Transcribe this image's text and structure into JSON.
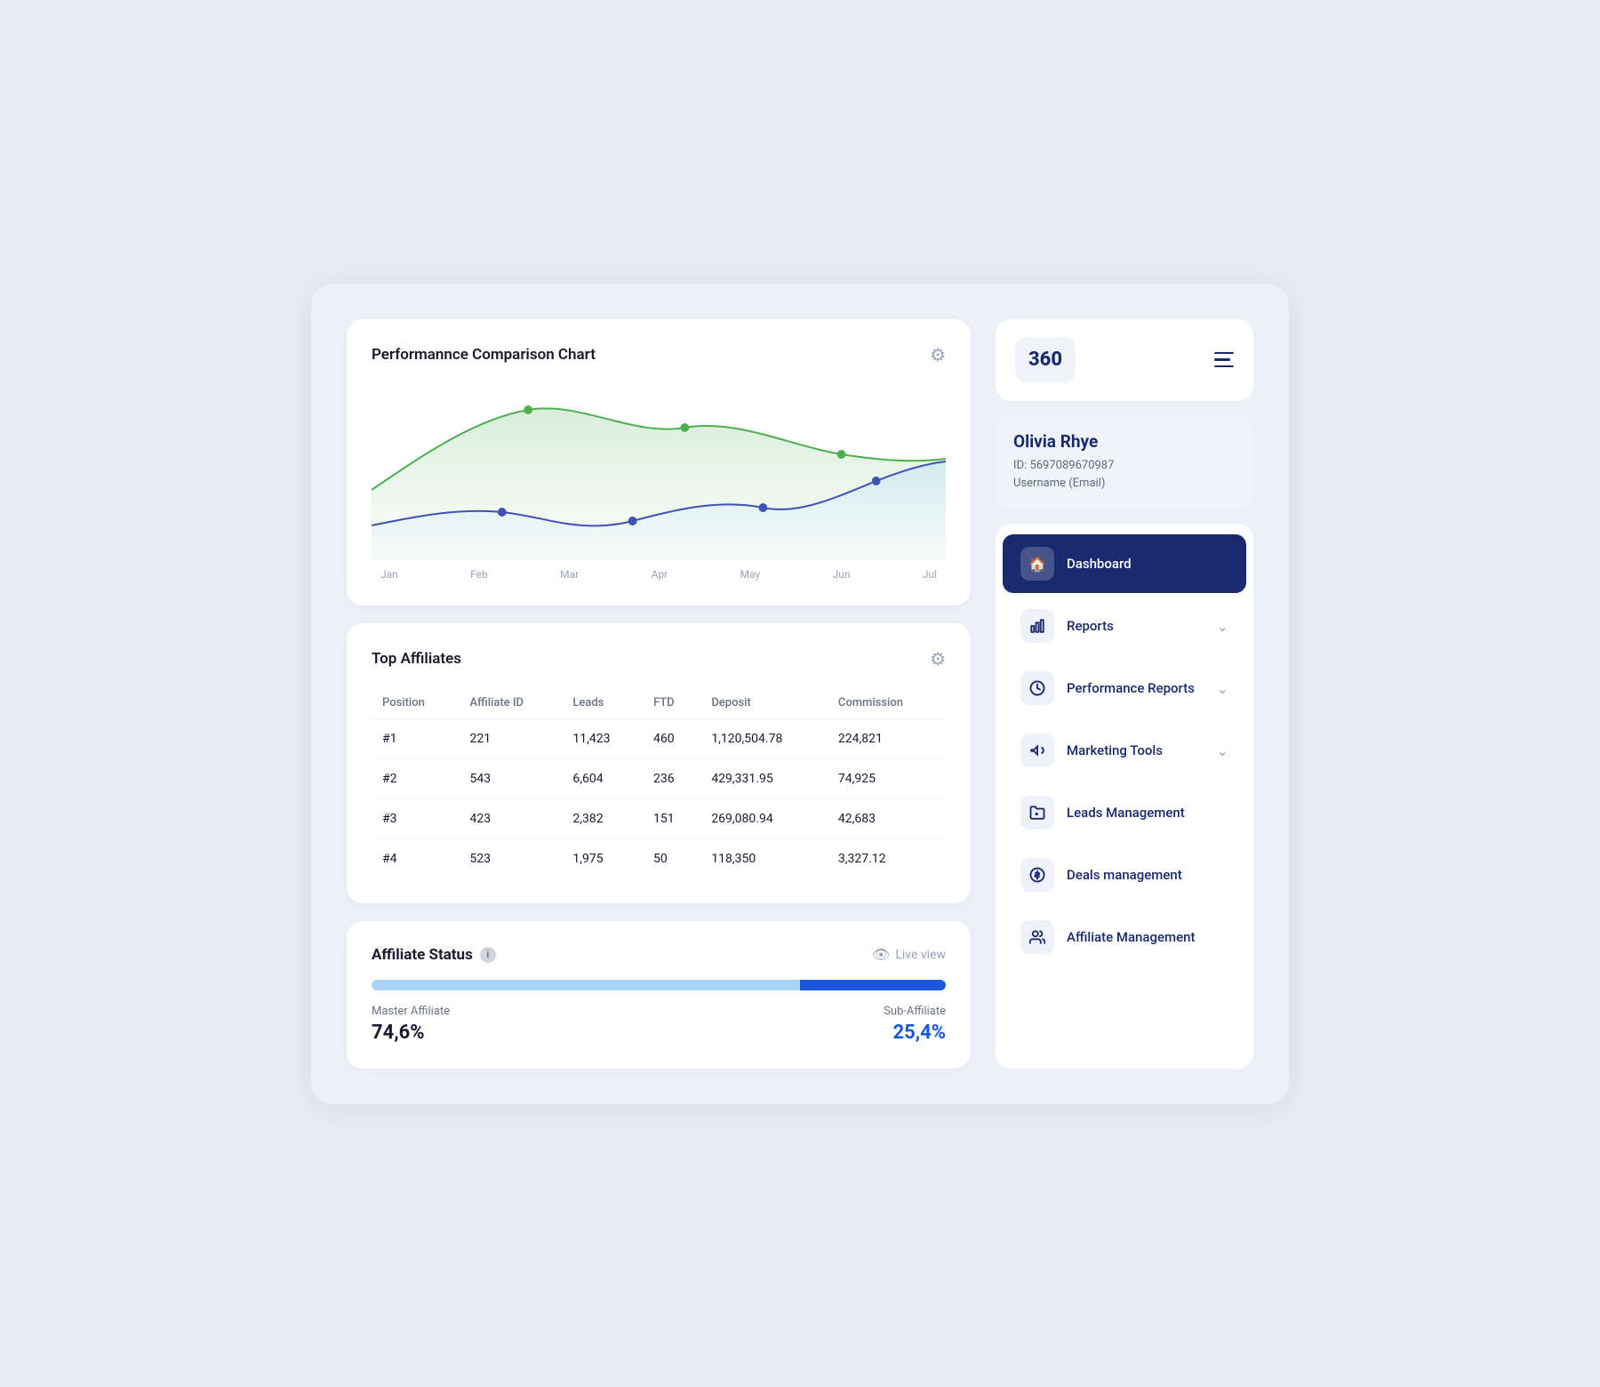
{
  "app": {
    "logo": "360",
    "brand_color": "#1a2a6e"
  },
  "user": {
    "name": "Olivia Rhye",
    "id_label": "ID: 5697089670987",
    "username_label": "Username (Email)"
  },
  "chart": {
    "title": "Performannce Comparison Chart",
    "months": [
      "Jan",
      "Feb",
      "Mar",
      "Apr",
      "May",
      "Jun",
      "Jul"
    ]
  },
  "top_affiliates": {
    "title": "Top Affiliates",
    "columns": [
      "Position",
      "Affiliate ID",
      "Leads",
      "FTD",
      "Deposit",
      "Commission"
    ],
    "rows": [
      {
        "position": "#1",
        "affiliate_id": "221",
        "leads": "11,423",
        "ftd": "460",
        "deposit": "1,120,504.78",
        "commission": "224,821"
      },
      {
        "position": "#2",
        "affiliate_id": "543",
        "leads": "6,604",
        "ftd": "236",
        "deposit": "429,331.95",
        "commission": "74,925"
      },
      {
        "position": "#3",
        "affiliate_id": "423",
        "leads": "2,382",
        "ftd": "151",
        "deposit": "269,080.94",
        "commission": "42,683"
      },
      {
        "position": "#4",
        "affiliate_id": "523",
        "leads": "1,975",
        "ftd": "50",
        "deposit": "118,350",
        "commission": "3,327.12"
      }
    ]
  },
  "affiliate_status": {
    "title": "Affiliate Status",
    "live_view_label": "Live view",
    "master_label": "Master Affiliate",
    "master_value": "74,6%",
    "master_pct": 74.6,
    "sub_label": "Sub-Affiliate",
    "sub_value": "25,4%",
    "sub_pct": 25.4
  },
  "nav": {
    "dashboard_label": "Dashboard",
    "items": [
      {
        "id": "dashboard",
        "label": "Dashboard",
        "active": true,
        "has_chevron": false
      },
      {
        "id": "reports",
        "label": "Reports",
        "active": false,
        "has_chevron": true
      },
      {
        "id": "performance-reports",
        "label": "Performance Reports",
        "active": false,
        "has_chevron": true
      },
      {
        "id": "marketing-tools",
        "label": "Marketing Tools",
        "active": false,
        "has_chevron": true
      },
      {
        "id": "leads-management",
        "label": "Leads Management",
        "active": false,
        "has_chevron": false
      },
      {
        "id": "deals-management",
        "label": "Deals management",
        "active": false,
        "has_chevron": false
      },
      {
        "id": "affiliate-management",
        "label": "Affiliate Management",
        "active": false,
        "has_chevron": false
      }
    ]
  }
}
